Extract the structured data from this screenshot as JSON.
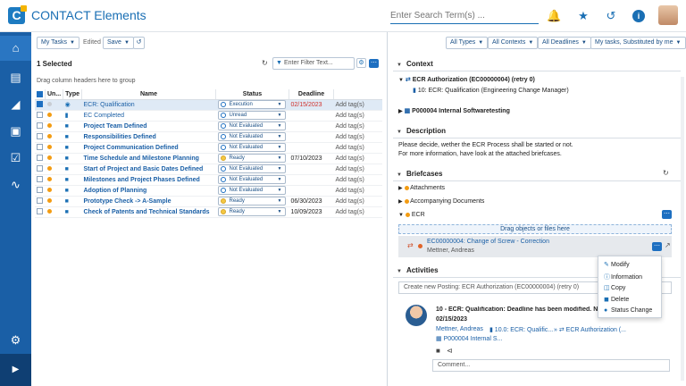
{
  "app": {
    "logo_letter": "C",
    "title": "CONTACT Elements",
    "search_placeholder": "Enter Search Term(s) ..."
  },
  "header_icons": [
    "bell-icon",
    "star-icon",
    "history-icon",
    "info-icon"
  ],
  "sidebar": {
    "items": [
      "home-icon",
      "document-icon",
      "parts-icon",
      "dashboard-icon",
      "tasks-icon",
      "activity-icon"
    ],
    "bottom": [
      "settings-icon",
      "expand-icon"
    ]
  },
  "toolbar": {
    "my_tasks": "My Tasks",
    "edited_label": "Edited",
    "save": "Save",
    "filters": [
      "All Types",
      "All Contexts",
      "All Deadlines",
      "My tasks, Substituted by me"
    ]
  },
  "list": {
    "selected": "1 Selected",
    "filter_placeholder": "Enter Filter Text...",
    "group_hint": "Drag column headers here to group",
    "columns": [
      "Un...",
      "Type",
      "Name",
      "Status",
      "Deadline"
    ],
    "rows": [
      {
        "name": "ECR: Qualification",
        "status": "Execution",
        "deadline": "02/15/2023",
        "tag": "Add tag(s)",
        "checked": true,
        "bold": false,
        "dot": "grey",
        "red": true
      },
      {
        "name": "EC Completed",
        "status": "Unread",
        "deadline": "",
        "tag": "Add tag(s)",
        "checked": false,
        "bold": false,
        "dot": "orange",
        "red": false
      },
      {
        "name": "Project Team Defined",
        "status": "Not Evaluated",
        "deadline": "",
        "tag": "Add tag(s)",
        "checked": false,
        "bold": true,
        "dot": "orange",
        "red": false
      },
      {
        "name": "Responsibilities Defined",
        "status": "Not Evaluated",
        "deadline": "",
        "tag": "Add tag(s)",
        "checked": false,
        "bold": true,
        "dot": "orange",
        "red": false
      },
      {
        "name": "Project Communication Defined",
        "status": "Not Evaluated",
        "deadline": "",
        "tag": "Add tag(s)",
        "checked": false,
        "bold": true,
        "dot": "orange",
        "red": false
      },
      {
        "name": "Time Schedule and Milestone Planning",
        "status": "Ready",
        "deadline": "07/10/2023",
        "tag": "Add tag(s)",
        "checked": false,
        "bold": true,
        "dot": "orange",
        "red": false
      },
      {
        "name": "Start of Project and Basic Dates Defined",
        "status": "Not Evaluated",
        "deadline": "",
        "tag": "Add tag(s)",
        "checked": false,
        "bold": true,
        "dot": "orange",
        "red": false
      },
      {
        "name": "Milestones and Project Phases Defined",
        "status": "Not Evaluated",
        "deadline": "",
        "tag": "Add tag(s)",
        "checked": false,
        "bold": true,
        "dot": "orange",
        "red": false
      },
      {
        "name": "Adoption of Planning",
        "status": "Not Evaluated",
        "deadline": "",
        "tag": "Add tag(s)",
        "checked": false,
        "bold": true,
        "dot": "orange",
        "red": false
      },
      {
        "name": "Prototype Check -> A-Sample",
        "status": "Ready",
        "deadline": "06/30/2023",
        "tag": "Add tag(s)",
        "checked": false,
        "bold": true,
        "dot": "orange",
        "red": false
      },
      {
        "name": "Check of Patents and Technical Standards",
        "status": "Ready",
        "deadline": "10/09/2023",
        "tag": "Add tag(s)",
        "checked": false,
        "bold": true,
        "dot": "orange",
        "red": false
      }
    ]
  },
  "detail": {
    "context_title": "Context",
    "context_item1": "ECR Authorization (EC00000004) (retry 0)",
    "context_item1_sub": "10: ECR: Qualification (Engineering Change Manager)",
    "context_item2": "P000004 Internal Softwaretesting",
    "description_title": "Description",
    "description_line1": "Please decide, wether the ECR Process shall be started or not.",
    "description_line2": "For more information, have look at the attached briefcases.",
    "briefcases_title": "Briefcases",
    "briefcases": [
      "Attachments",
      "Accompanying Documents",
      "ECR"
    ],
    "dropzone": "Drag objects or files here",
    "doc_title": "EC00000004: Change of Screw - Correction",
    "doc_owner": "Mettner, Andreas",
    "activities_title": "Activities",
    "posting_placeholder": "Create new Posting: ECR Authorization (EC00000004) (retry 0)",
    "activity_text": "10 - ECR: Qualification: Deadline has been modified. New dea",
    "activity_date": "02/15/2023",
    "activity_author": "Mettner, Andreas",
    "activity_ref1": "10.0: ECR: Qualific...",
    "activity_ref2": "ECR Authorization (...",
    "activity_ref3": "P000004 Internal S...",
    "comment_placeholder": "Comment..."
  },
  "context_menu": [
    "Modify",
    "Information",
    "Copy",
    "Delete",
    "Status Change"
  ],
  "colors": {
    "brand": "#1a5fa6",
    "accent": "#1d6fc1",
    "warning": "#f39c12",
    "deadline_red": "#d0302b"
  }
}
